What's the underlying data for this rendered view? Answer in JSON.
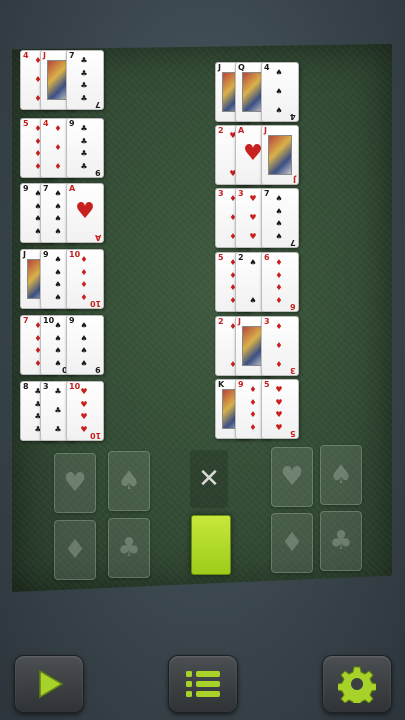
{
  "stacks": [
    {
      "cards": [
        {
          "rank": "4",
          "suit": "♦",
          "color": "red"
        },
        {
          "rank": "J",
          "suit": "♦",
          "color": "red",
          "face": true
        },
        {
          "rank": "7",
          "suit": "♣",
          "color": "black"
        }
      ]
    },
    {
      "cards": [
        {
          "rank": "5",
          "suit": "♦",
          "color": "red"
        },
        {
          "rank": "4",
          "suit": "♦",
          "color": "red"
        },
        {
          "rank": "9",
          "suit": "♣",
          "color": "black"
        }
      ]
    },
    {
      "cards": [
        {
          "rank": "9",
          "suit": "♠",
          "color": "black"
        },
        {
          "rank": "7",
          "suit": "♠",
          "color": "black"
        },
        {
          "rank": "A",
          "suit": "♥",
          "color": "red"
        }
      ]
    },
    {
      "cards": [
        {
          "rank": "J",
          "suit": "♣",
          "color": "black",
          "face": true
        },
        {
          "rank": "9",
          "suit": "♠",
          "color": "black"
        },
        {
          "rank": "10",
          "suit": "♦",
          "color": "red"
        }
      ]
    },
    {
      "cards": [
        {
          "rank": "7",
          "suit": "♦",
          "color": "red"
        },
        {
          "rank": "10",
          "suit": "♠",
          "color": "black"
        },
        {
          "rank": "9",
          "suit": "♠",
          "color": "black"
        }
      ]
    },
    {
      "cards": [
        {
          "rank": "8",
          "suit": "♣",
          "color": "black"
        },
        {
          "rank": "3",
          "suit": "♣",
          "color": "black"
        },
        {
          "rank": "10",
          "suit": "♥",
          "color": "red"
        }
      ]
    },
    {
      "cards": [
        {
          "rank": "J",
          "suit": "♠",
          "color": "black",
          "face": true
        },
        {
          "rank": "Q",
          "suit": "♣",
          "color": "black",
          "face": true
        },
        {
          "rank": "4",
          "suit": "♠",
          "color": "black"
        }
      ]
    },
    {
      "cards": [
        {
          "rank": "2",
          "suit": "♥",
          "color": "red"
        },
        {
          "rank": "A",
          "suit": "♥",
          "color": "red"
        },
        {
          "rank": "J",
          "suit": "♥",
          "color": "red",
          "face": true
        }
      ]
    },
    {
      "cards": [
        {
          "rank": "3",
          "suit": "♦",
          "color": "red"
        },
        {
          "rank": "3",
          "suit": "♥",
          "color": "red"
        },
        {
          "rank": "7",
          "suit": "♠",
          "color": "black"
        }
      ]
    },
    {
      "cards": [
        {
          "rank": "5",
          "suit": "♦",
          "color": "red"
        },
        {
          "rank": "2",
          "suit": "♠",
          "color": "black"
        },
        {
          "rank": "6",
          "suit": "♦",
          "color": "red"
        }
      ]
    },
    {
      "cards": [
        {
          "rank": "2",
          "suit": "♦",
          "color": "red"
        },
        {
          "rank": "J",
          "suit": "♦",
          "color": "red",
          "face": true
        },
        {
          "rank": "3",
          "suit": "♦",
          "color": "red"
        }
      ]
    },
    {
      "cards": [
        {
          "rank": "K",
          "suit": "♣",
          "color": "black",
          "face": true
        },
        {
          "rank": "9",
          "suit": "♦",
          "color": "red"
        },
        {
          "rank": "5",
          "suit": "♥",
          "color": "red"
        }
      ]
    }
  ],
  "foundations": [
    {
      "suit": "♥"
    },
    {
      "suit": "♠"
    },
    {
      "suit": "♦"
    },
    {
      "suit": "♣"
    },
    {
      "suit": "♥"
    },
    {
      "suit": "♠"
    },
    {
      "suit": "♦"
    },
    {
      "suit": "♣"
    }
  ],
  "cancel_symbol": "✕",
  "colors": {
    "felt": "#334b34",
    "accent": "#9ccc1a",
    "red_suit": "#c8201e",
    "black_suit": "#1a1a1a"
  },
  "toolbar": {
    "play_icon": "play-icon",
    "menu_icon": "menu-icon",
    "settings_icon": "gear-icon"
  }
}
